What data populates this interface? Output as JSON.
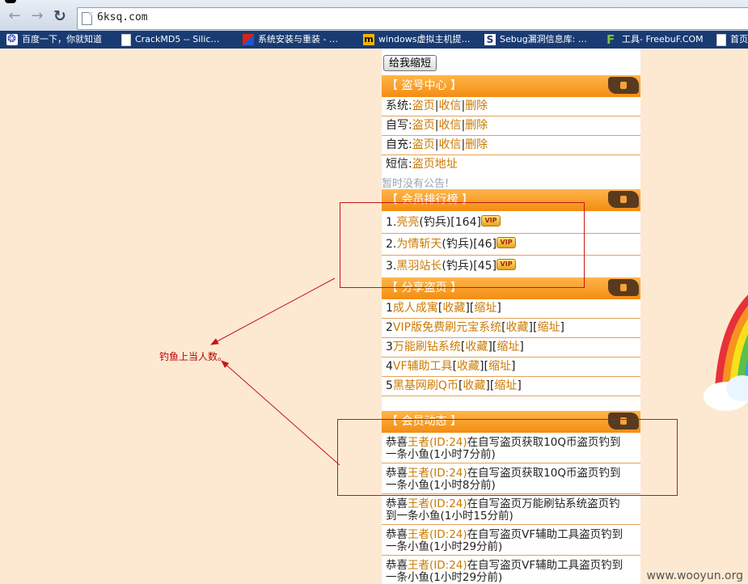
{
  "browser": {
    "url": "6ksq.com",
    "bookmarks": [
      {
        "label": "百度一下，你就知道",
        "icon": "baidu-paw-icon"
      },
      {
        "label": "CrackMD5 -- Silic…",
        "icon": "page-icon"
      },
      {
        "label": "系统安装与重装 - …",
        "icon": "red-blue-icon"
      },
      {
        "label": "windows虚拟主机提…",
        "icon": "m-logo-icon"
      },
      {
        "label": "Sebug漏洞信息库: …",
        "icon": "s-logo-icon"
      },
      {
        "label": "工具- FreebuF.COM",
        "icon": "f-logo-icon"
      },
      {
        "label": "首页",
        "icon": "page-icon"
      }
    ]
  },
  "shrink_button": "给我缩短",
  "account_center": {
    "title": "【 盗号中心 】",
    "rows": [
      {
        "prefix": "系统:",
        "links": [
          "盗页",
          "收信",
          "删除"
        ]
      },
      {
        "prefix": "自写:",
        "links": [
          "盗页",
          "收信",
          "删除"
        ]
      },
      {
        "prefix": "自充:",
        "links": [
          "盗页",
          "收信",
          "删除"
        ]
      },
      {
        "prefix": "短信:",
        "links": [
          "盗页地址"
        ]
      }
    ]
  },
  "notice": "暂时没有公告!",
  "ranking": {
    "title": "【 会员排行榜 】",
    "rows": [
      {
        "rank": "1.",
        "name": "亮亮",
        "role": "(钓兵)",
        "count": "[164]",
        "vip": "VIP"
      },
      {
        "rank": "2.",
        "name": "为情斩天",
        "role": "(钓兵)",
        "count": "[46]",
        "vip": "VIP"
      },
      {
        "rank": "3.",
        "name": "黑羽站长",
        "role": "(钓兵)",
        "count": "[45]",
        "vip": "VIP"
      }
    ]
  },
  "share": {
    "title": "【 分享盗页 】",
    "rows": [
      {
        "num": "1",
        "name": "成人成寓",
        "fav": "收藏",
        "short": "缩址"
      },
      {
        "num": "2",
        "name": "VIP版免费刷元宝系统",
        "fav": "收藏",
        "short": "缩址"
      },
      {
        "num": "3",
        "name": "万能刷钻系统",
        "fav": "收藏",
        "short": "缩址"
      },
      {
        "num": "4",
        "name": "VF辅助工具",
        "fav": "收藏",
        "short": "缩址"
      },
      {
        "num": "5",
        "name": "黑基网刷Q币",
        "fav": "收藏",
        "short": "缩址"
      }
    ]
  },
  "feed": {
    "title": "【 会员动态 】",
    "items": [
      {
        "pre": "恭喜",
        "user": "王者(ID:24)",
        "line1": "在自写盗页获取10Q币盗页钓到",
        "line2": "一条小鱼(1小时7分前)"
      },
      {
        "pre": "恭喜",
        "user": "王者(ID:24)",
        "line1": "在自写盗页获取10Q币盗页钓到",
        "line2": "一条小鱼(1小时8分前)"
      },
      {
        "pre": "恭喜",
        "user": "王者(ID:24)",
        "line1": "在自写盗页万能刷钻系统盗页钓",
        "line2": "到一条小鱼(1小时15分前)"
      },
      {
        "pre": "恭喜",
        "user": "王者(ID:24)",
        "line1": "在自写盗页VF辅助工具盗页钓到",
        "line2": "一条小鱼(1小时29分前)"
      },
      {
        "pre": "恭喜",
        "user": "王者(ID:24)",
        "line1": "在自写盗页VF辅助工具盗页钓到",
        "line2": "一条小鱼(1小时29分前)"
      }
    ]
  },
  "annotation": "钓鱼上当人数。",
  "watermark": "www.wooyun.org",
  "colors": {
    "section_header": "#f38d12",
    "link": "#cc7a00",
    "annotation": "#c51616",
    "page_bg": "#fde9d2"
  }
}
